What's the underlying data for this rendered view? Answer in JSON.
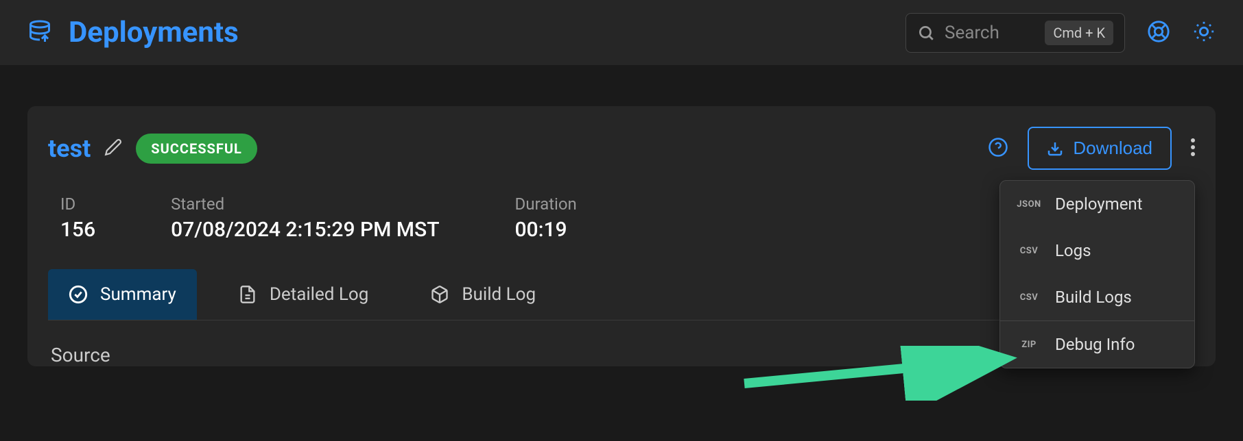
{
  "header": {
    "title": "Deployments",
    "search_placeholder": "Search",
    "kbd_hint": "Cmd  +  K"
  },
  "deployment": {
    "name": "test",
    "status": "SUCCESSFUL",
    "download_label": "Download",
    "meta": {
      "id_label": "ID",
      "id_value": "156",
      "started_label": "Started",
      "started_value": "07/08/2024 2:15:29 PM MST",
      "duration_label": "Duration",
      "duration_value": "00:19"
    }
  },
  "tabs": {
    "summary": "Summary",
    "detailed_log": "Detailed Log",
    "build_log": "Build Log"
  },
  "dropdown": {
    "items": [
      {
        "badge": "JSON",
        "label": "Deployment"
      },
      {
        "badge": "CSV",
        "label": "Logs"
      },
      {
        "badge": "CSV",
        "label": "Build Logs"
      },
      {
        "badge": "ZIP",
        "label": "Debug Info"
      }
    ]
  },
  "section": {
    "source": "Source"
  }
}
